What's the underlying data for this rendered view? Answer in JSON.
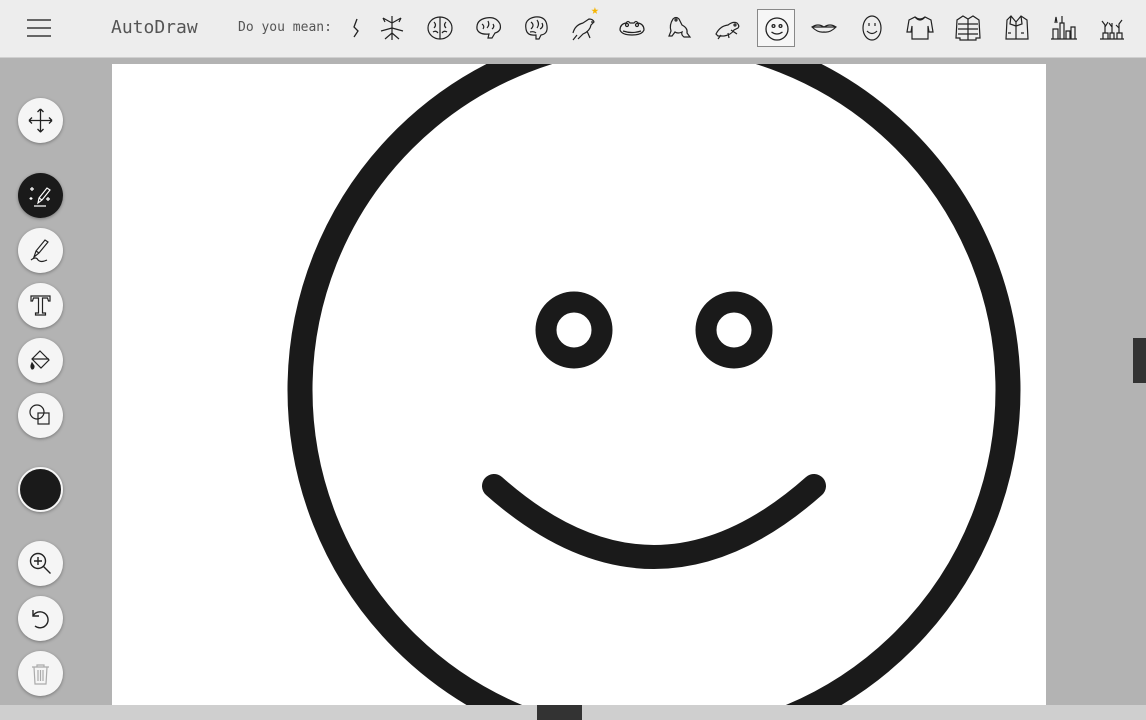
{
  "app": {
    "title": "AutoDraw"
  },
  "suggestions": {
    "label": "Do you mean:",
    "items": [
      {
        "name": "partial"
      },
      {
        "name": "tree-sketch"
      },
      {
        "name": "brain"
      },
      {
        "name": "brain-side"
      },
      {
        "name": "brain-3d"
      },
      {
        "name": "frog-starred",
        "starred": true
      },
      {
        "name": "frog-face"
      },
      {
        "name": "frog-sitting"
      },
      {
        "name": "frog-leaping"
      },
      {
        "name": "smiley-face",
        "selected": true
      },
      {
        "name": "lips"
      },
      {
        "name": "smiley-oval"
      },
      {
        "name": "sweater"
      },
      {
        "name": "jacket-puffer"
      },
      {
        "name": "jacket"
      },
      {
        "name": "cityscape"
      },
      {
        "name": "plants"
      }
    ]
  },
  "toolbar": {
    "tools": [
      {
        "name": "move",
        "icon": "move-icon"
      },
      {
        "name": "autodraw",
        "icon": "autodraw-icon",
        "active": true
      },
      {
        "name": "draw",
        "icon": "pencil-icon"
      },
      {
        "name": "type",
        "icon": "text-icon"
      },
      {
        "name": "fill",
        "icon": "fill-bucket-icon"
      },
      {
        "name": "shape",
        "icon": "shape-icon"
      }
    ],
    "color": "#1a1a1a",
    "actions": [
      {
        "name": "zoom",
        "icon": "zoom-in-icon"
      },
      {
        "name": "undo",
        "icon": "undo-icon"
      },
      {
        "name": "delete",
        "icon": "trash-icon",
        "disabled": true
      }
    ]
  },
  "colors": {
    "ink": "#1a1a1a",
    "accent_star": "#f5b400",
    "bg": "#b3b3b3"
  }
}
